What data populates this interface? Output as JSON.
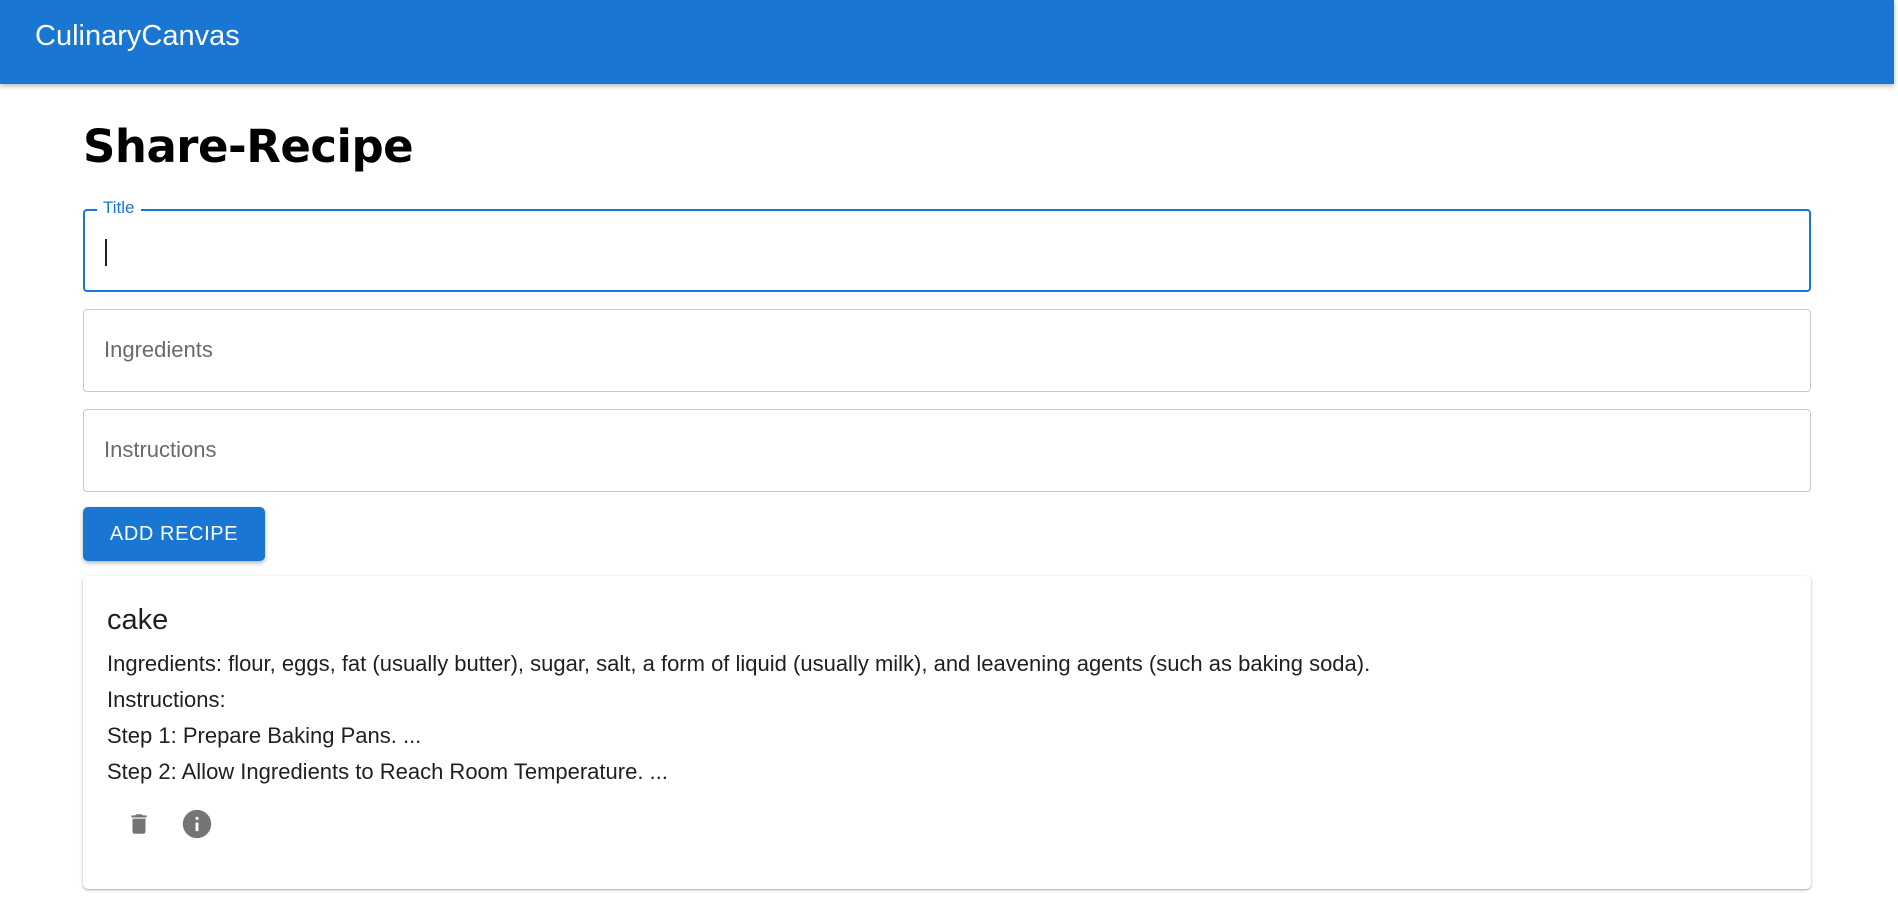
{
  "app": {
    "title": "CulinaryCanvas"
  },
  "page": {
    "title": "Share-Recipe"
  },
  "form": {
    "title_label": "Title",
    "title_value": "",
    "ingredients_placeholder": "Ingredients",
    "instructions_placeholder": "Instructions",
    "submit_label": "ADD RECIPE"
  },
  "recipes": [
    {
      "title": "cake",
      "ingredients": "Ingredients: flour, eggs, fat (usually butter), sugar, salt, a form of liquid (usually milk), and leavening agents (such as baking soda).",
      "instructions_heading": "Instructions:",
      "steps": [
        "Step 1: Prepare Baking Pans. ...",
        "Step 2: Allow Ingredients to Reach Room Temperature. ..."
      ],
      "actions": [
        {
          "icon": "delete-icon"
        },
        {
          "icon": "info-icon"
        }
      ]
    }
  ],
  "colors": {
    "primary": "#1976d2",
    "icon_gray": "#757575",
    "text": "#1f1f1f",
    "placeholder": "#6a6a6a"
  }
}
